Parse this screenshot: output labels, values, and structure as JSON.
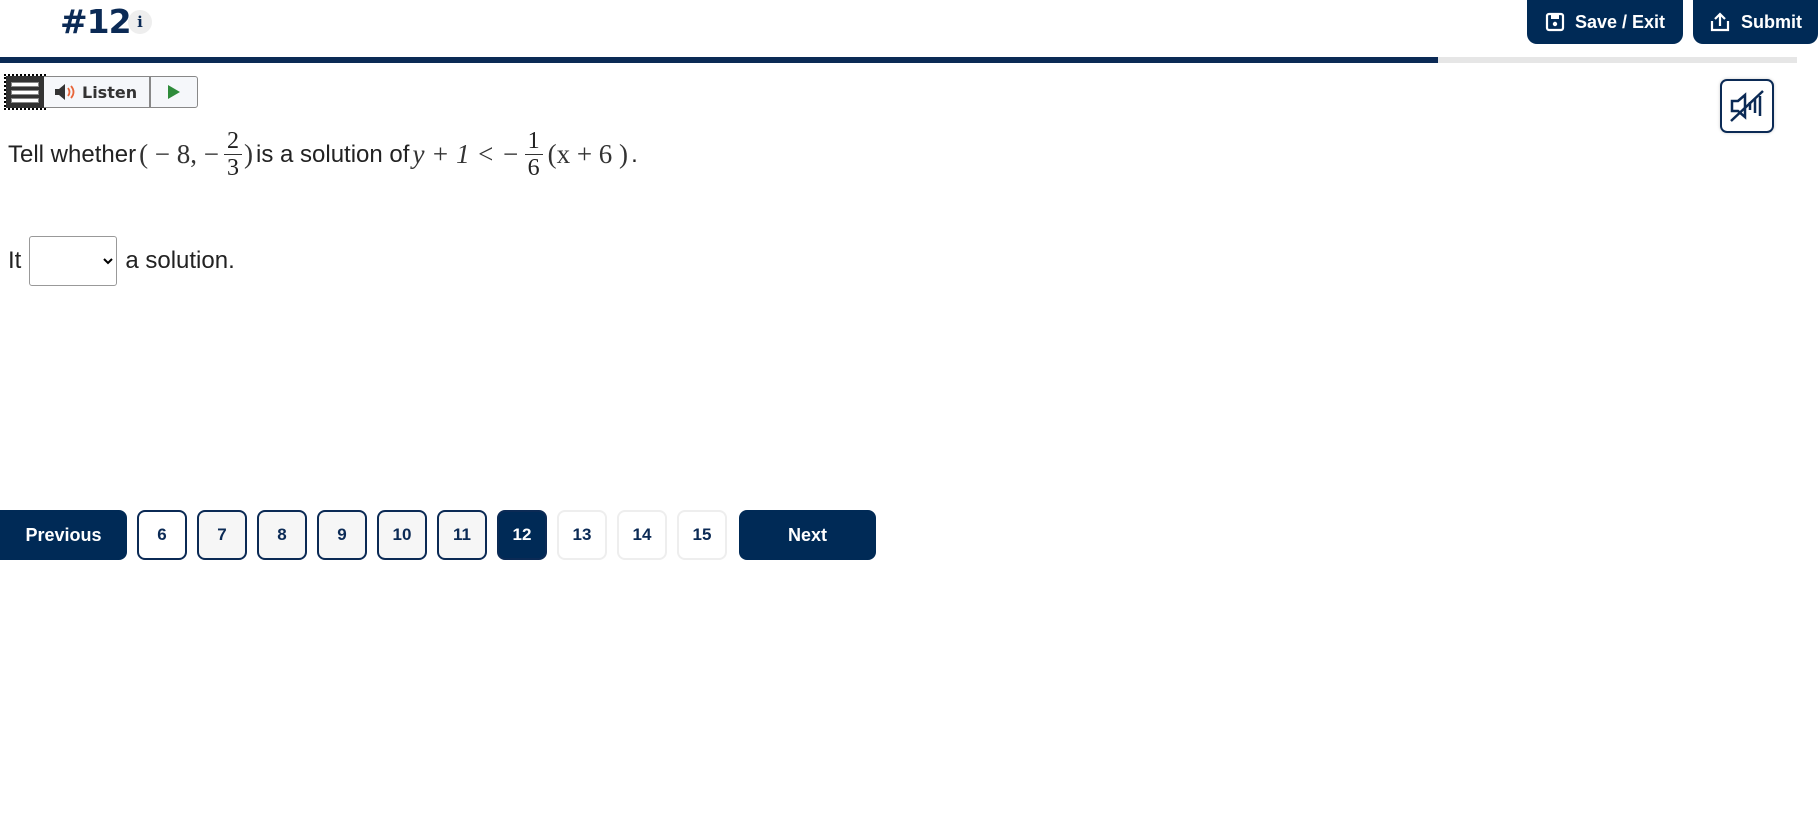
{
  "header": {
    "question_number": "#12",
    "info_label": "i",
    "save_exit_label": "Save / Exit",
    "submit_label": "Submit",
    "progress_percent": 80
  },
  "toolbar": {
    "listen_label": "Listen",
    "icons": [
      "menu-icon",
      "speaker-icon",
      "play-icon",
      "mute-icon"
    ]
  },
  "question": {
    "intro": "Tell whether",
    "point_open": "( − 8,  −",
    "point_frac_num": "2",
    "point_frac_den": "3",
    "point_close": ")",
    "middle": "is a solution of",
    "lhs": "y + 1 < −",
    "rhs_frac_num": "1",
    "rhs_frac_den": "6",
    "rhs_tail": "(x + 6 )",
    "end": "."
  },
  "answer": {
    "prefix": "It",
    "select_value": "",
    "suffix": "a solution."
  },
  "pagination": {
    "previous_label": "Previous",
    "next_label": "Next",
    "current_page": "12",
    "pages": [
      {
        "label": "6",
        "state": "visited-first"
      },
      {
        "label": "7",
        "state": "visited"
      },
      {
        "label": "8",
        "state": "visited"
      },
      {
        "label": "9",
        "state": "visited"
      },
      {
        "label": "10",
        "state": "visited"
      },
      {
        "label": "11",
        "state": "visited"
      },
      {
        "label": "12",
        "state": "current"
      },
      {
        "label": "13",
        "state": "unvisited"
      },
      {
        "label": "14",
        "state": "unvisited"
      },
      {
        "label": "15",
        "state": "unvisited"
      }
    ]
  },
  "colors": {
    "primary": "#002a56",
    "play": "#2e8b3a",
    "speaker_accent": "#e8663a"
  }
}
